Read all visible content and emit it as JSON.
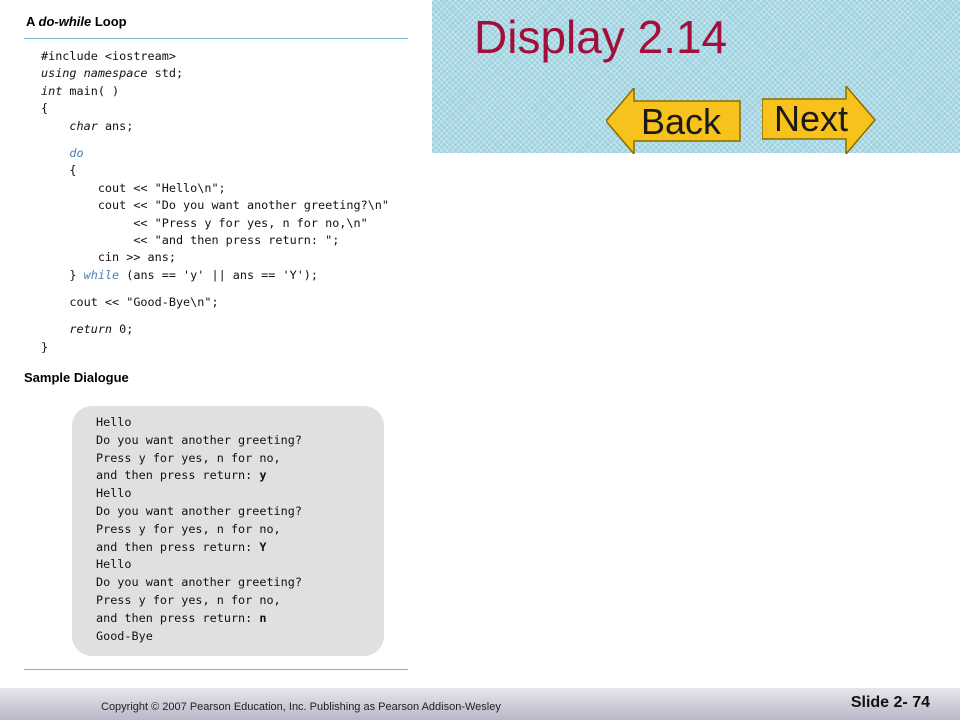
{
  "slide": {
    "title": "Display 2.14",
    "back_label": "Back",
    "next_label": "Next",
    "copyright": "Copyright © 2007 Pearson Education, Inc. Publishing as Pearson Addison-Wesley",
    "slide_number": "Slide 2- 74"
  },
  "display": {
    "title_prefix": "A ",
    "title_italic": "do-while",
    "title_suffix": " Loop",
    "code": {
      "include": "#include <iostream>",
      "using_kw": "using namespace",
      "using_rest": " std;",
      "int_kw": "int",
      "main_rest": " main( )",
      "open_brace": "{",
      "char_indent": "    ",
      "char_kw": "char",
      "char_rest": " ans;",
      "do_indent": "    ",
      "do_kw": "do",
      "do_brace": "    {",
      "cout1": "        cout << \"Hello\\n\";",
      "cout2": "        cout << \"Do you want another greeting?\\n\"",
      "cout3": "             << \"Press y for yes, n for no,\\n\"",
      "cout4": "             << \"and then press return: \";",
      "cin": "        cin >> ans;",
      "while_prefix": "    } ",
      "while_kw": "while",
      "while_rest": " (ans == 'y' || ans == 'Y');",
      "goodbye": "    cout << \"Good-Bye\\n\";",
      "return_indent": "    ",
      "return_kw": "return",
      "return_rest": " 0;",
      "close_brace": "}"
    },
    "sample_heading": "Sample Dialogue",
    "dialogue": {
      "l1": "Hello",
      "l2": "Do you want another greeting?",
      "l3": "Press y for yes, n for no,",
      "l4_text": "and then press return: ",
      "l4_input": "y",
      "l5": "Hello",
      "l6": "Do you want another greeting?",
      "l7": "Press y for yes, n for no,",
      "l8_text": "and then press return: ",
      "l8_input": "Y",
      "l9": "Hello",
      "l10": "Do you want another greeting?",
      "l11": "Press y for yes, n for no,",
      "l12_text": "and then press return: ",
      "l12_input": "n",
      "l13": "Good-Bye"
    }
  },
  "colors": {
    "title": "#a0103a",
    "banner": "#9fd2e0",
    "button": "#f7c21b",
    "keyword_blue": "#4a7fb0"
  }
}
